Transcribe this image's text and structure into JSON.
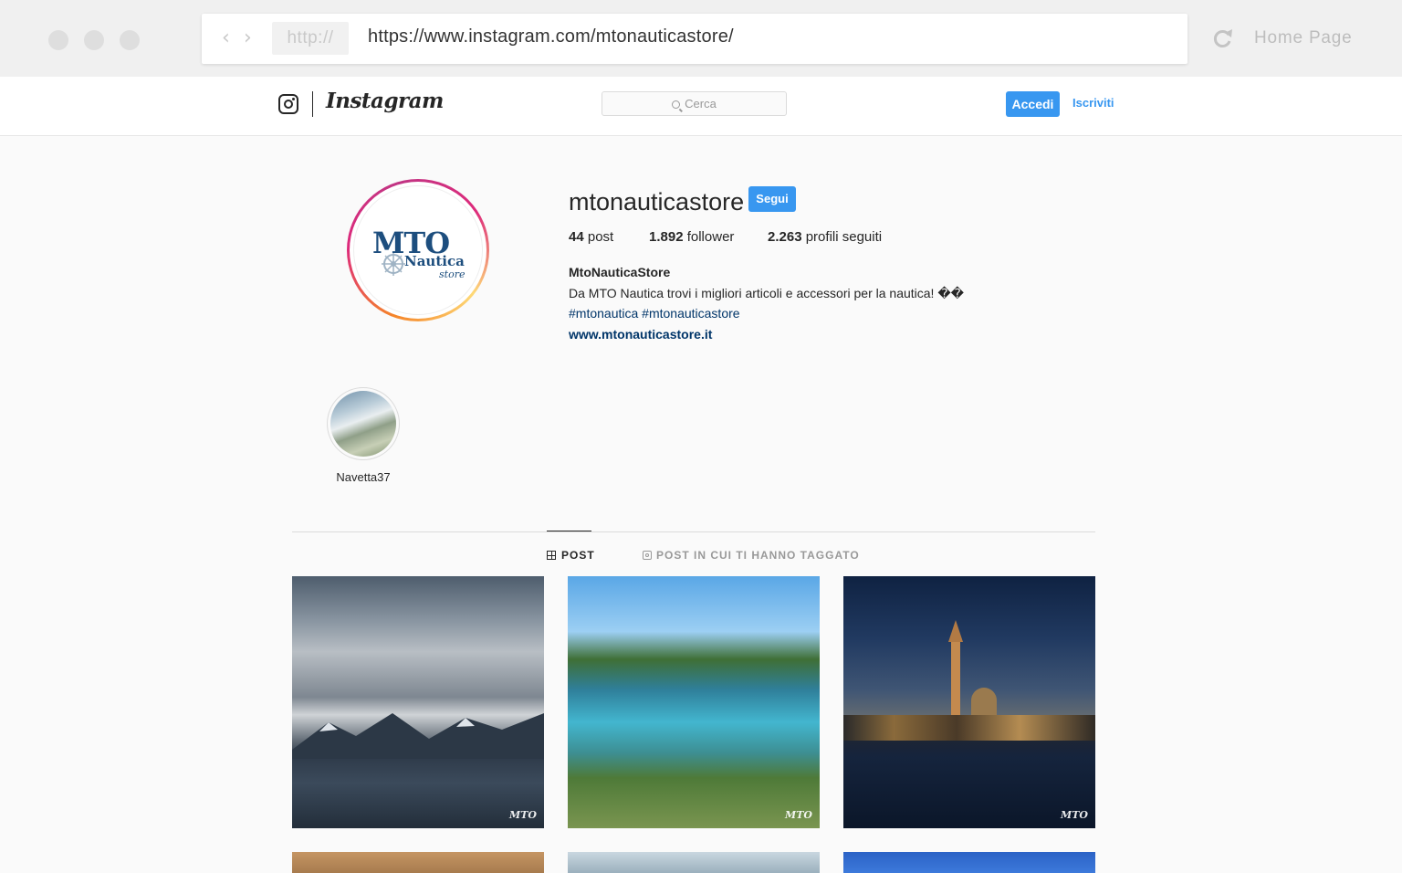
{
  "browser": {
    "protocol": "http://",
    "url": "https://www.instagram.com/mtonauticastore/",
    "home_label": "Home Page"
  },
  "header": {
    "wordmark": "Instagram",
    "search_placeholder": "Cerca",
    "login_label": "Accedi",
    "signup_label": "Iscriviti"
  },
  "profile": {
    "avatar_text": {
      "mto": "MTO",
      "nautica": "Nautica",
      "store": "store"
    },
    "username": "mtonauticastore",
    "follow_label": "Segui",
    "stats": [
      {
        "count": "44",
        "label": "post"
      },
      {
        "count": "1.892",
        "label": "follower"
      },
      {
        "count": "2.263",
        "label": "profili seguiti"
      }
    ],
    "full_name": "MtoNauticaStore",
    "bio": "Da MTO Nautica trovi i migliori articoli e accessori per la nautica! ��",
    "hashtags": "#mtonautica #mtonauticastore",
    "website": "www.mtonauticastore.it"
  },
  "highlights": [
    {
      "label": "Navetta37"
    }
  ],
  "tabs": [
    {
      "label": "POST",
      "icon": "grid-icon",
      "active": true
    },
    {
      "label": "POST IN CUI TI HANNO TAGGATO",
      "icon": "tagged-icon",
      "active": false
    }
  ],
  "colors": {
    "accent": "#3897f0",
    "link": "#003569"
  }
}
